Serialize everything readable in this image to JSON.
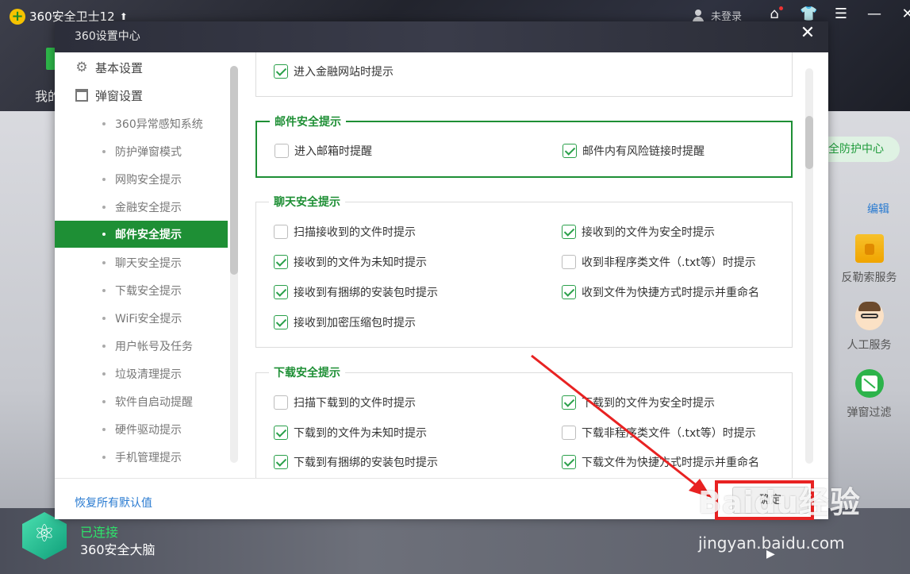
{
  "app": {
    "title": "360安全卫士12",
    "account": "未登录",
    "bg_label": "我的",
    "brain_status": "已连接",
    "brain_name": "360安全大脑"
  },
  "right_panel": {
    "pill": "全防护中心",
    "edit": "编辑",
    "items": [
      "反勒索服务",
      "人工服务",
      "弹窗过滤"
    ]
  },
  "dialog": {
    "title": "360设置中心",
    "restore_label": "恢复所有默认值",
    "ok_label": "确定",
    "sidebar": {
      "basic": "基本设置",
      "popup": "弹窗设置",
      "items": [
        "360异常感知系统",
        "防护弹窗模式",
        "网购安全提示",
        "金融安全提示",
        "邮件安全提示",
        "聊天安全提示",
        "下载安全提示",
        "WiFi安全提示",
        "用户帐号及任务",
        "垃圾清理提示",
        "软件自启动提醒",
        "硬件驱动提示",
        "手机管理提示"
      ]
    },
    "groups": {
      "finance": {
        "options": [
          {
            "label": "进入金融网站时提示",
            "checked": true
          }
        ]
      },
      "mail": {
        "title": "邮件安全提示",
        "options": [
          {
            "label": "进入邮箱时提醒",
            "checked": false
          },
          {
            "label": "邮件内有风险链接时提醒",
            "checked": true
          }
        ]
      },
      "chat": {
        "title": "聊天安全提示",
        "options": [
          {
            "label": "扫描接收到的文件时提示",
            "checked": false
          },
          {
            "label": "接收到的文件为安全时提示",
            "checked": true
          },
          {
            "label": "接收到的文件为未知时提示",
            "checked": true
          },
          {
            "label": "收到非程序类文件（.txt等）时提示",
            "checked": false
          },
          {
            "label": "接收到有捆绑的安装包时提示",
            "checked": true
          },
          {
            "label": "收到文件为快捷方式时提示并重命名",
            "checked": true
          },
          {
            "label": "接收到加密压缩包时提示",
            "checked": true
          }
        ]
      },
      "download": {
        "title": "下载安全提示",
        "options": [
          {
            "label": "扫描下载到的文件时提示",
            "checked": false
          },
          {
            "label": "下载到的文件为安全时提示",
            "checked": true
          },
          {
            "label": "下载到的文件为未知时提示",
            "checked": true
          },
          {
            "label": "下载非程序类文件（.txt等）时提示",
            "checked": false
          },
          {
            "label": "下载到有捆绑的安装包时提示",
            "checked": true
          },
          {
            "label": "下载文件为快捷方式时提示并重命名",
            "checked": true
          }
        ]
      }
    }
  },
  "watermark": {
    "brand": "Baidu经验",
    "url": "jingyan.baidu.com"
  },
  "colors": {
    "accent": "#1e8f35",
    "link": "#2a7bd1",
    "highlight": "#e82222"
  }
}
